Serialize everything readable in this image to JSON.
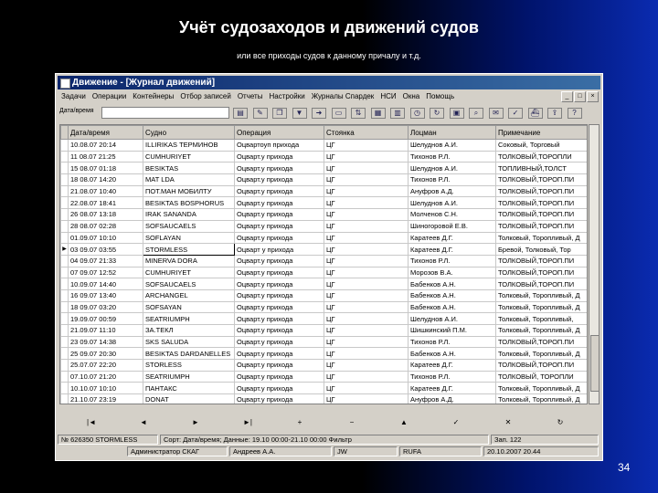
{
  "slide": {
    "title": "Учёт судозаходов и движений судов",
    "subtitle": "или все приходы судов к данному причалу и т.д.",
    "page_number": "34"
  },
  "window": {
    "title": "Движение - [Журнал движений]",
    "menu": [
      "Задачи",
      "Операции",
      "Контейнеры",
      "Отбор записей",
      "Отчеты",
      "Настройки",
      "Журналы Спардек",
      "НСИ",
      "Окна",
      "Помощь"
    ],
    "window_buttons": [
      "_",
      "□",
      "×"
    ]
  },
  "toolbar": {
    "search_label": "Дата/время",
    "search_value": ""
  },
  "grid": {
    "columns": [
      "Дата/время",
      "Судно",
      "Операция",
      "Стоянка",
      "Лоцман",
      "Примечание"
    ],
    "rows": [
      [
        "10.08.07 20:14",
        "ILLIRIKAS ТЕРМИНОВ",
        "Оцвартоуп прихода",
        "ЦГ",
        "Шелуднов А.И.",
        "Соковый, Торговый"
      ],
      [
        "11 08.07 21:25",
        "CUMHURIYET",
        "Оцварт.у прихода",
        "ЦГ",
        "Тихонов Р.Л.",
        "ТОЛКОВЫЙ,ТОРОПЛИ"
      ],
      [
        "15 08.07 01:18",
        "BESIKTAS",
        "Оцварт.у прихода",
        "ЦГ",
        "Шелуднов А.И.",
        "ТОПЛИВНЫЙ,ТОЛСТ"
      ],
      [
        "18 08.07 14:20",
        "MAT LDA",
        "Оцварт.у прихода",
        "ЦГ",
        "Тихонов Р.Л.",
        "ТОЛКОВЫЙ,ТОРОП.ПИ"
      ],
      [
        "21.08.07 10:40",
        "ПОТ.МАН МОБИЛТУ",
        "Оцварт.у прихода",
        "ЦГ",
        "Ануфров А.Д.",
        "ТОЛКОВЫЙ,ТОРОП.ПИ"
      ],
      [
        "22.08.07 18:41",
        "BESIKTAS BOSPHORUS",
        "Оцварт.у прихода",
        "ЦГ",
        "Шелуднов А.И.",
        "ТОЛКОВЫЙ,ТОРОП.ПИ"
      ],
      [
        "26 08.07 13:18",
        "IRAK SANANDA",
        "Оцварт.у прихода",
        "ЦГ",
        "Молченов С.Н.",
        "ТОЛКОВЫЙ,ТОРОП.ПИ"
      ],
      [
        "28 08.07 02:28",
        "SOFSAUCAELS",
        "Оцварт.у прихода",
        "ЦГ",
        "Шиногоровой Е.В.",
        "ТОЛКОВЫЙ,ТОРОП.ПИ"
      ],
      [
        "01.09.07 10:10",
        "SOFLAYAN",
        "Оцварт.у прихода",
        "ЦГ",
        "Каратеев Д.Г.",
        "Толковый, Торопливый, Д"
      ],
      [
        "03 09.07 03:55",
        "STORMLESS",
        "Оцварт у прихода",
        "ЦГ",
        "Каратеев Д.Г.",
        "Бревой, Толковый, Тор"
      ],
      [
        "04 09.07 21:33",
        "MINERVA DORA",
        "Оцварт.у прихода",
        "ЦГ",
        "Тихонов Р.Л.",
        "ТОЛКОВЫЙ,ТОРОП.ПИ"
      ],
      [
        "07 09.07 12:52",
        "CUMHURIYET",
        "Оцварт.у прихода",
        "ЦГ",
        "Морозов В.А.",
        "ТОЛКОВЫЙ,ТОРОП.ПИ"
      ],
      [
        "10.09.07 14:40",
        "SOFSAUCAELS",
        "Оцварт.у прихода",
        "ЦГ",
        "Бабенков А.Н.",
        "ТОЛКОВЫЙ,ТОРОП.ПИ"
      ],
      [
        "16 09.07 13:40",
        "ARCHANGEL",
        "Оцварт.у прихода",
        "ЦГ",
        "Бабенков А.Н.",
        "Толковый, Торопливый, Д"
      ],
      [
        "18 09.07 03:20",
        "SOFSAYAN",
        "Оцварт.у прихода",
        "ЦГ",
        "Бабенков А.Н.",
        "Толковый, Торопливый, Д"
      ],
      [
        "19.09.07 00:59",
        "SEATRIUMPH",
        "Оцварт.у прихода",
        "ЦГ",
        "Шелуднов А.И.",
        "Толковый, Торопливый,"
      ],
      [
        "21.09.07 11:10",
        "ЗА.ТЕКЛ",
        "Оцварт.у прихода",
        "ЦГ",
        "Шишкинский П.М.",
        "Толковый, Торопливый, Д"
      ],
      [
        "23 09.07 14:38",
        "SKS SALUDA",
        "Оцварт.у прихода",
        "ЦГ",
        "Тихонов Р.Л.",
        "ТОЛКОВЫЙ,ТОРОП.ПИ"
      ],
      [
        "25 09.07 20:30",
        "BESIKTAS DARDANELLES",
        "Оцварт.у прихода",
        "ЦГ",
        "Бабенков А.Н.",
        "Толковый, Торопливый, Д"
      ],
      [
        "25.07.07 22:20",
        "STORLESS",
        "Оцварт.у прихода",
        "ЦГ",
        "Каратеев Д.Г.",
        "ТОЛКОВЫЙ,ТОРОП.ПИ"
      ],
      [
        "07.10.07 21:20",
        "SEATRIUMPH",
        "Оцварт.у прихода",
        "ЦГ",
        "Тихонов Р.Л.",
        "ТОЛКОВЫЙ, ТОРОПЛИ"
      ],
      [
        "10.10.07 10:10",
        "ПАНТАКС",
        "Оцварт.у прихода",
        "ЦГ",
        "Каратеев Д.Г.",
        "Толковый, Торопливый, Д"
      ],
      [
        "21.10.07 23:19",
        "DONAT",
        "Оцварт.у прихода",
        "ЦГ",
        "Ануфров А.Д.",
        "Толковый, Торопливый, Д"
      ]
    ],
    "selected_row_index": 9
  },
  "navbar": {
    "buttons": [
      "|◄",
      "◄",
      "►",
      "►|",
      "+",
      "−",
      "▲",
      "✓",
      "✕",
      "↻"
    ]
  },
  "status": {
    "row1": [
      "№ 626350 STORMLESS",
      "Сорт: Дата/время; Данные: 19.10 00:00-21.10 00:00 Фильтр",
      "Зап. 122"
    ],
    "row2": [
      "Администратор СКАГ",
      "Андреев А.А.",
      "JW",
      "RUFA",
      "20.10.2007 20.44"
    ]
  },
  "colors": {
    "titlebar_start": "#0a246a",
    "titlebar_end": "#3a6ea5",
    "window_bg": "#d4d0c8",
    "slide_bg": "#000000",
    "slide_accent": "#0a2bb0"
  }
}
